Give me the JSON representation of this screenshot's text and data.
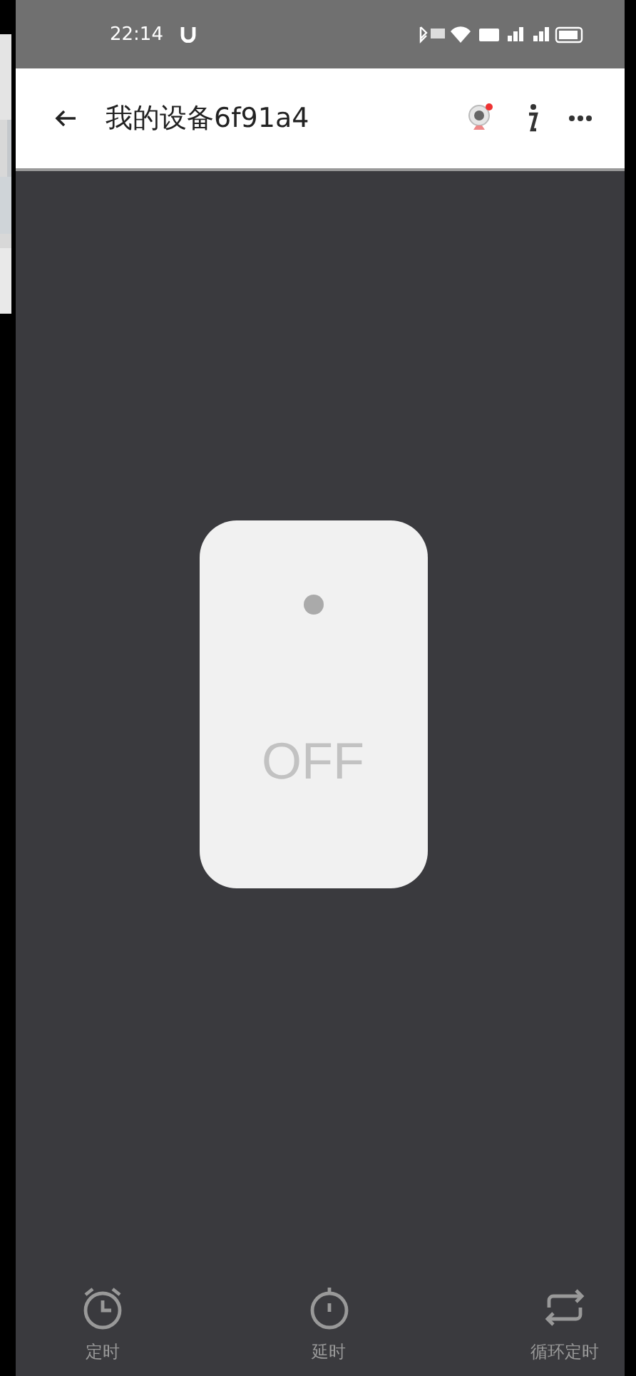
{
  "status_bar": {
    "time": "22:14"
  },
  "header": {
    "title": "我的设备6f91a4"
  },
  "switch": {
    "on": false,
    "label": "OFF"
  },
  "bottom_bar": [
    {
      "kind": "alarm",
      "label": "定时"
    },
    {
      "kind": "stopwatch",
      "label": "延时"
    },
    {
      "kind": "repeat",
      "label": "循环定时"
    }
  ]
}
